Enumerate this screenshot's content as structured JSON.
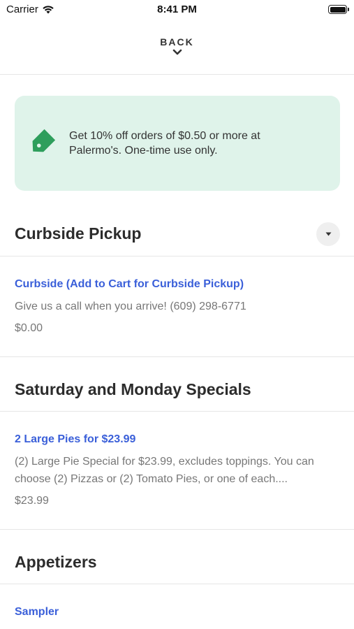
{
  "status_bar": {
    "carrier": "Carrier",
    "time": "8:41 PM"
  },
  "header": {
    "back_label": "BACK"
  },
  "promo": {
    "text": "Get 10% off orders of $0.50 or more at Palermo's. One-time use only.",
    "accent_color": "#2e9e5c",
    "background_color": "#dff3ea"
  },
  "sections": [
    {
      "title": "Curbside Pickup",
      "items": [
        {
          "name": "Curbside (Add to Cart for Curbside Pickup)",
          "description": "Give us a call when you arrive! (609) 298-6771",
          "price": "$0.00"
        }
      ]
    },
    {
      "title": "Saturday and Monday Specials",
      "items": [
        {
          "name": "2 Large Pies for $23.99",
          "description": "(2) Large Pie Special for $23.99, excludes toppings. You can choose (2) Pizzas or (2) Tomato Pies, or one of each....",
          "price": "$23.99"
        }
      ]
    },
    {
      "title": "Appetizers",
      "items": [
        {
          "name": "Sampler"
        }
      ]
    }
  ],
  "colors": {
    "link": "#3a5fd9",
    "muted_text": "#777777",
    "divider": "#e6e6e6"
  }
}
